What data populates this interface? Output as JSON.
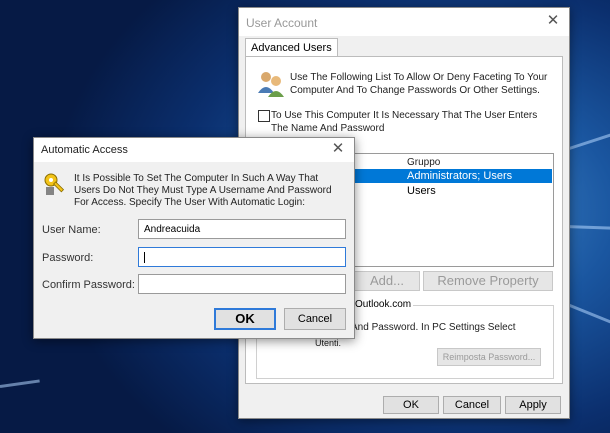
{
  "user_account": {
    "title": "User Account",
    "tab_label": "Advanced Users",
    "intro_text": "Use The Following List To Allow Or Deny Faceting To Your Computer And To Change Passwords Or Other Settings.",
    "checkbox_label": "To Use This Computer It Is Necessary That The User Enters The Name And Password",
    "group_header": "Gruppo",
    "groups": [
      "Administrators; Users",
      "Users"
    ],
    "add_button": "Add...",
    "remove_button": "Remove Property",
    "outlook_text": "Outlook.com",
    "password_text": "And Password. In PC Settings Select",
    "utenti_text": "Utenti.",
    "reset_password_button": "Reimposta Password...",
    "ok_button": "OK",
    "cancel_button": "Cancel",
    "apply_button": "Apply"
  },
  "automatic_access": {
    "title": "Automatic Access",
    "description": "It Is Possible To Set The Computer In Such A Way That Users Do Not They Must Type A Username And Password For Access. Specify The User With Automatic Login:",
    "username_label": "User Name:",
    "username_value": "Andreacuida",
    "password_label": "Password:",
    "confirm_label": "Confirm Password:",
    "ok_button": "OK",
    "cancel_button": "Cancel"
  },
  "colors": {
    "selection": "#0078d7",
    "desktop": "#1a56a0",
    "default_button_border": "#2f7ad9"
  }
}
